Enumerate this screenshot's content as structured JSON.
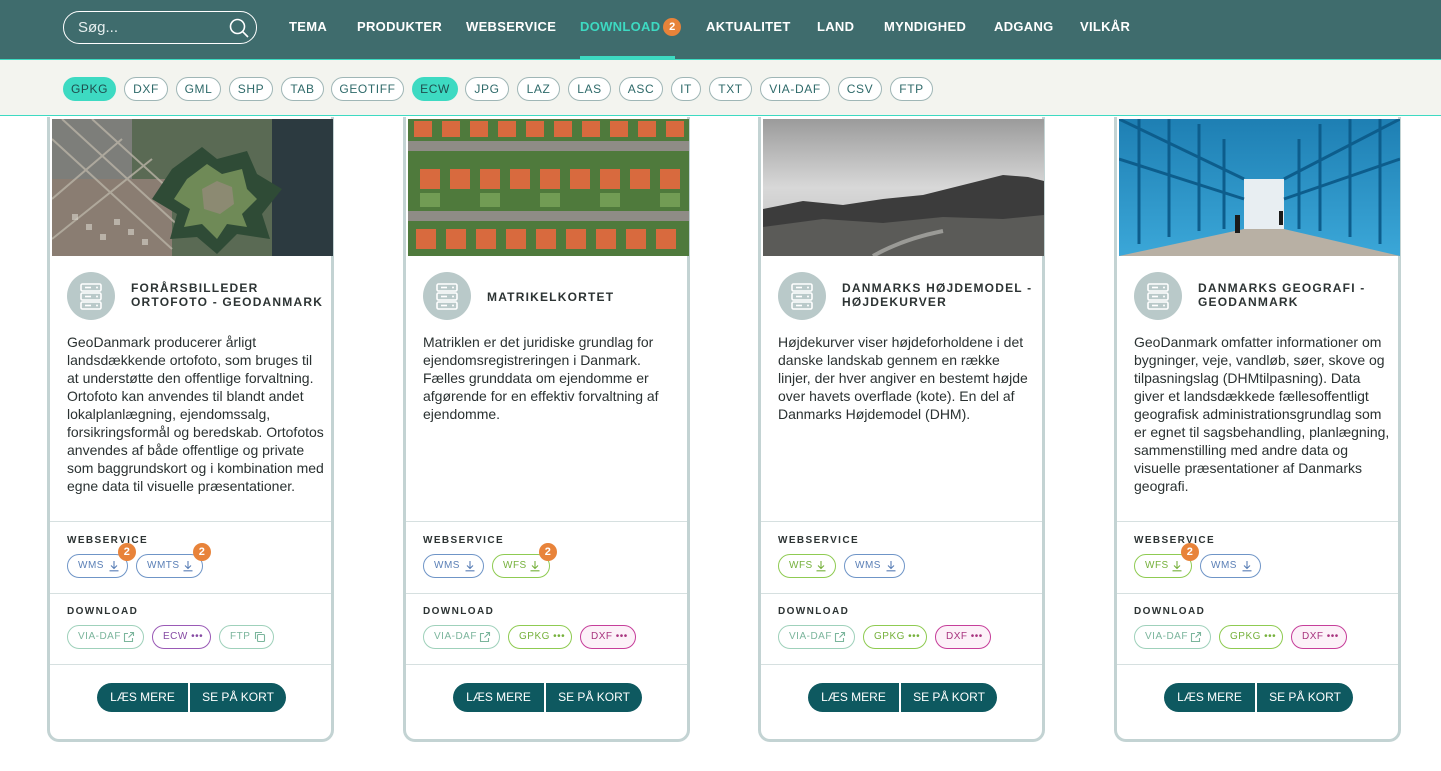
{
  "search": {
    "placeholder": "Søg..."
  },
  "nav": {
    "items": [
      "TEMA",
      "PRODUKTER",
      "WEBSERVICE",
      "DOWNLOAD",
      "AKTUALITET",
      "LAND",
      "MYNDIGHED",
      "ADGANG",
      "VILKÅR"
    ],
    "download_badge": "2",
    "active": "DOWNLOAD"
  },
  "formats": {
    "items": [
      "GPKG",
      "DXF",
      "GML",
      "SHP",
      "TAB",
      "GEOTIFF",
      "ECW",
      "JPG",
      "LAZ",
      "LAS",
      "ASC",
      "IT",
      "TXT",
      "VIA-DAF",
      "CSV",
      "FTP"
    ],
    "selected": [
      "GPKG",
      "ECW"
    ]
  },
  "labels": {
    "webservice": "WEBSERVICE",
    "download": "DOWNLOAD",
    "read_more": "LÆS MERE",
    "see_map": "SE PÅ KORT"
  },
  "cards": [
    {
      "title": "FORÅRSBILLEDER ORTOFOTO - GEODANMARK",
      "description": "GeoDanmark producerer årligt landsdækkende ortofoto, som bruges til at understøtte den offentlige forvaltning. Ortofoto kan anvendes til blandt andet lokalplanlægning, ejendomssalg, forsikringsformål og beredskab. Ortofotos anvendes af både offentlige og private som baggrundskort og i kombination med egne data til visuelle præsentationer.",
      "webservices": [
        {
          "label": "WMS",
          "badge": "2"
        },
        {
          "label": "WMTS",
          "badge": "2"
        }
      ],
      "downloads": [
        {
          "label": "VIA-DAF"
        },
        {
          "label": "ECW •••"
        },
        {
          "label": "FTP"
        }
      ]
    },
    {
      "title": "MATRIKELKORTET",
      "description": "Matriklen er det juridiske grundlag for ejendomsregistreringen i Danmark. Fælles grunddata om ejendomme er afgørende for en effektiv forvaltning af ejendomme.",
      "webservices": [
        {
          "label": "WMS"
        },
        {
          "label": "WFS",
          "badge": "2"
        }
      ],
      "downloads": [
        {
          "label": "VIA-DAF"
        },
        {
          "label": "GPKG •••"
        },
        {
          "label": "DXF •••"
        }
      ]
    },
    {
      "title": "DANMARKS HØJDEMODEL - HØJDEKURVER",
      "description": "Højdekurver viser højdeforholdene i det danske landskab gennem en række linjer, der hver angiver en bestemt højde over havets overflade (kote). En del af Danmarks Højdemodel (DHM).",
      "webservices": [
        {
          "label": "WFS"
        },
        {
          "label": "WMS"
        }
      ],
      "downloads": [
        {
          "label": "VIA-DAF"
        },
        {
          "label": "GPKG •••"
        },
        {
          "label": "DXF •••"
        }
      ]
    },
    {
      "title": "DANMARKS GEOGRAFI - GEODANMARK",
      "description": "GeoDanmark omfatter informationer om bygninger, veje, vandløb, søer, skove og tilpasningslag (DHMtilpasning). Data giver et landsdækkede fællesoffentligt geografisk administrationsgrundlag som er egnet til sagsbehandling, planlægning, sammenstilling med andre data og visuelle præsentationer af Danmarks geografi.",
      "webservices": [
        {
          "label": "WFS",
          "badge": "2"
        },
        {
          "label": "WMS"
        }
      ],
      "downloads": [
        {
          "label": "VIA-DAF"
        },
        {
          "label": "GPKG •••"
        },
        {
          "label": "DXF •••"
        }
      ]
    }
  ]
}
